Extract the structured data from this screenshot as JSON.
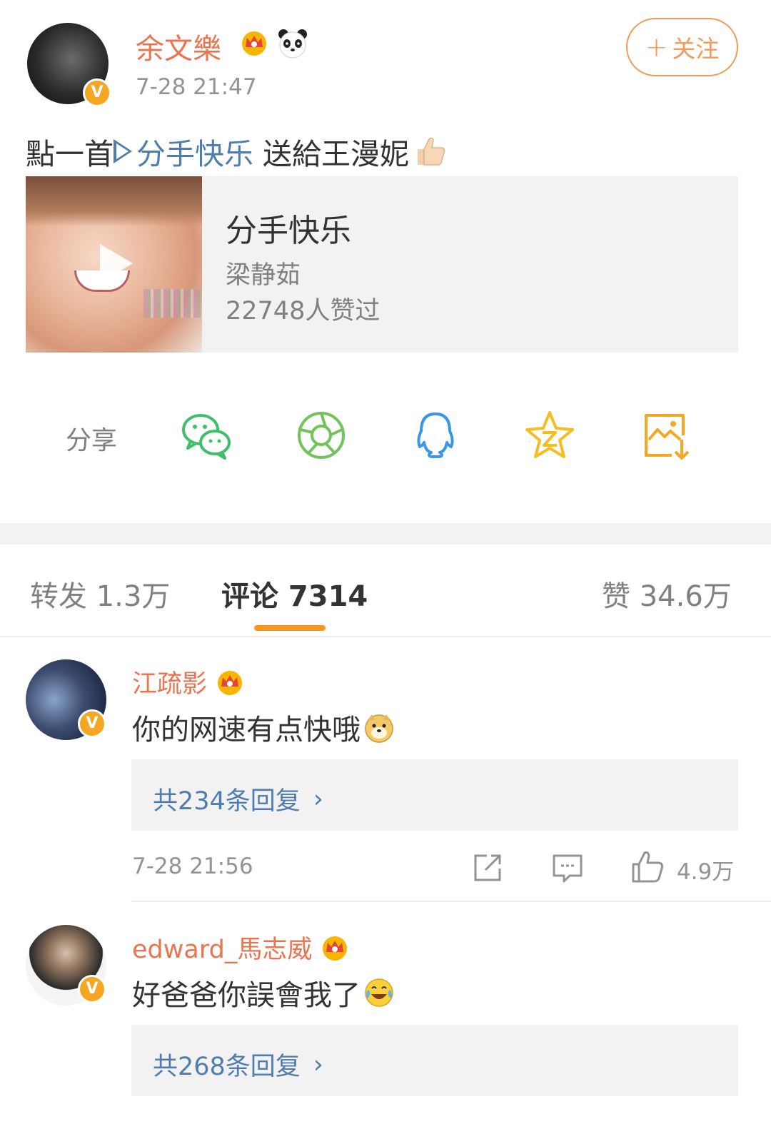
{
  "post": {
    "author": "余文樂",
    "time": "7-28 21:47",
    "follow_label": "关注",
    "text_before": "點一首",
    "link_text": "分手快乐",
    "text_after": " 送給王漫妮"
  },
  "music_card": {
    "title": "分手快乐",
    "artist": "梁静茹",
    "likes": "22748人赞过"
  },
  "share": {
    "label": "分享",
    "targets": [
      "wechat",
      "moments",
      "qq",
      "qzone",
      "save-image"
    ]
  },
  "tabs": {
    "repost": "转发 1.3万",
    "comments": "评论 7314",
    "likes": "赞 34.6万"
  },
  "comments": [
    {
      "author": "江疏影",
      "text": "你的网速有点快哦",
      "replies": "共234条回复",
      "time": "7-28 21:56",
      "likes": "4.9万"
    },
    {
      "author": "edward_馬志威",
      "text": "好爸爸你誤會我了",
      "replies": "共268条回复"
    }
  ],
  "colors": {
    "username": "#eb7350",
    "link": "#507daf",
    "accent": "#f59822",
    "muted": "#939393"
  }
}
